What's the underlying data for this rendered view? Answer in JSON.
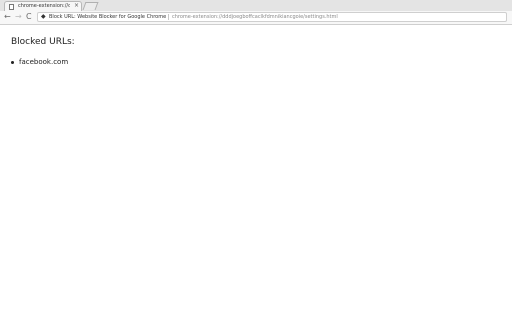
{
  "tab": {
    "title": "chrome-extension://ddd",
    "close": "×"
  },
  "toolbar": {
    "back": "←",
    "forward": "→",
    "reload": "C",
    "extension_label": "Block URL: Website Blocker for Google Chrome",
    "url": "chrome-extension://dddjoegboffcaclkfdmnikiancgoie/settings.html"
  },
  "page": {
    "title": "Blocked URLs:",
    "blocked_urls": [
      "facebook.com"
    ]
  }
}
